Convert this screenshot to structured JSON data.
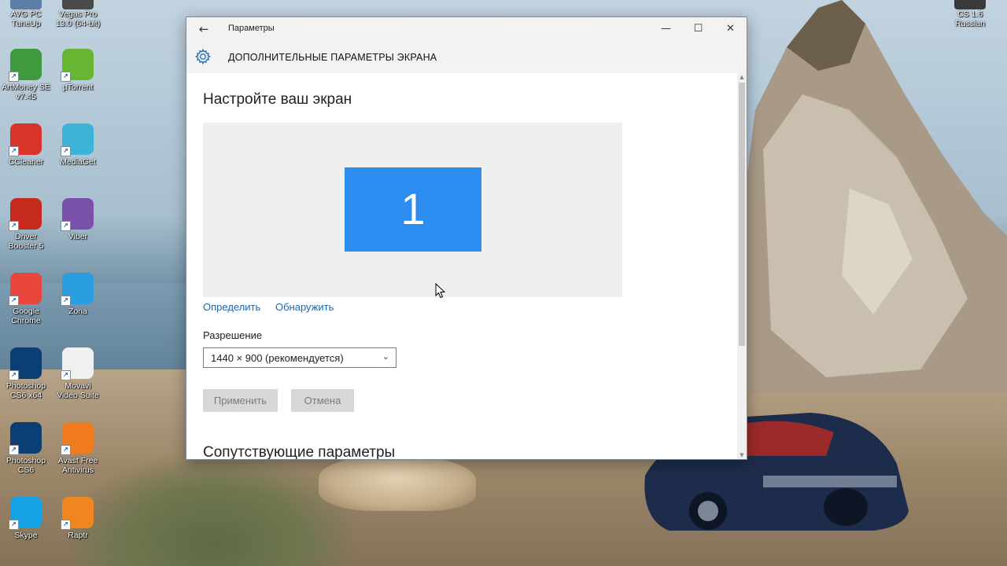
{
  "desktop": {
    "icons_left": [
      {
        "label": "AVG PC\nTuneUp",
        "icon": "avg-icon",
        "color": "#5b7fa6"
      },
      {
        "label": "ArtMoney SE\nv7.45",
        "icon": "artmoney-icon",
        "color": "#3f9a3f"
      },
      {
        "label": "CCleaner",
        "icon": "ccleaner-icon",
        "color": "#d8352a"
      },
      {
        "label": "Driver\nBooster 5",
        "icon": "driver-booster-icon",
        "color": "#c62a1f"
      },
      {
        "label": "Google\nChrome",
        "icon": "chrome-icon",
        "color": "#e8453c"
      },
      {
        "label": "Photoshop\nCS6 x64",
        "icon": "photoshop-icon",
        "color": "#0b3e73"
      },
      {
        "label": "Photoshop\nCS6",
        "icon": "photoshop-icon",
        "color": "#0b3e73"
      },
      {
        "label": "Skype",
        "icon": "skype-icon",
        "color": "#16a2e4"
      }
    ],
    "icons_right": [
      {
        "label": "Vegas Pro\n13.0 (64-bit)",
        "icon": "vegas-icon",
        "color": "#4a4a4a"
      },
      {
        "label": "µTorrent",
        "icon": "utorrent-icon",
        "color": "#66b533"
      },
      {
        "label": "MediaGet",
        "icon": "mediaget-icon",
        "color": "#3eb3d8"
      },
      {
        "label": "Viber",
        "icon": "viber-icon",
        "color": "#7a51a8"
      },
      {
        "label": "Zona",
        "icon": "zona-icon",
        "color": "#2a9ee0"
      },
      {
        "label": "Movavi\nVideo Suite",
        "icon": "movavi-icon",
        "color": "#f0f0f0"
      },
      {
        "label": "Avast Free\nAntivirus",
        "icon": "avast-icon",
        "color": "#f07c1f"
      },
      {
        "label": "Raptr",
        "icon": "raptr-icon",
        "color": "#f0861f"
      }
    ],
    "icon_far_right": {
      "label": "CS 1.6\nRussian",
      "icon": "cs-icon",
      "color": "#3a3a3a"
    }
  },
  "window": {
    "title": "Параметры",
    "header": "ДОПОЛНИТЕЛЬНЫЕ ПАРАМЕТРЫ ЭКРАНА",
    "heading": "Настройте ваш экран",
    "monitor_number": "1",
    "links": {
      "identify": "Определить",
      "detect": "Обнаружить"
    },
    "resolution_label": "Разрешение",
    "resolution_value": "1440 × 900 (рекомендуется)",
    "buttons": {
      "apply": "Применить",
      "cancel": "Отмена"
    },
    "related_heading": "Сопутствующие параметры",
    "accent_color": "#2d8cf0"
  }
}
